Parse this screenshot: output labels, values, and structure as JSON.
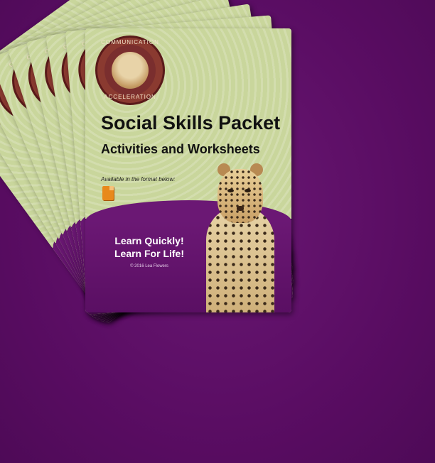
{
  "book": {
    "seal_top": "COMMUNICATION",
    "seal_bottom": "ACCELERATION",
    "title": "Social Skills Packet",
    "subtitle": "Activities and Worksheets",
    "availability": "Available in the format below:",
    "slogan_line1": "Learn Quickly!",
    "slogan_line2": "Learn For Life!",
    "copyright": "© 2016 Lea Flowers"
  },
  "icons": {
    "seal": "cheetah-seal-icon",
    "file": "file-format-icon"
  },
  "colors": {
    "background": "#5a0d63",
    "cover_green": "#c9d69c",
    "cover_purple_band": "#6b1874",
    "seal_ring": "#7a2e2e"
  },
  "fan": {
    "copies": 9
  }
}
